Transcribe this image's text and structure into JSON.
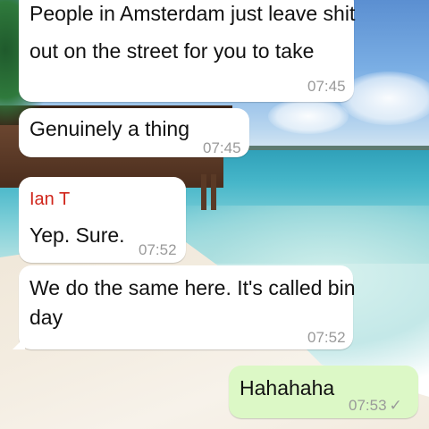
{
  "messages": [
    {
      "line1": "People in Amsterdam just leave shit",
      "line2": "out on the street for you to take",
      "time": "07:45"
    },
    {
      "text": "Genuinely a thing",
      "time": "07:45"
    },
    {
      "sender": "Ian T",
      "text": "Yep. Sure.",
      "time": "07:52"
    },
    {
      "line1": "We do the same here. It's called bin",
      "line2": "day",
      "time": "07:52"
    },
    {
      "text": "Hahahaha",
      "time": "07:53",
      "status": "✓"
    }
  ],
  "colors": {
    "incoming_bubble": "#ffffff",
    "outgoing_bubble": "#dcf8c6",
    "sender_name": "#d0251b",
    "timestamp": "#9a9a9a"
  },
  "icons": {
    "sent_status": "check-icon"
  }
}
